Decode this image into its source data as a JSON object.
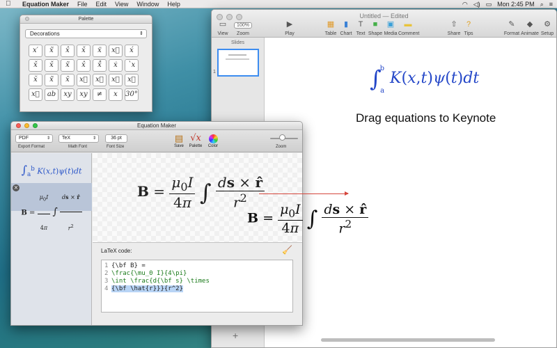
{
  "menubar": {
    "app_name": "Equation Maker",
    "items": [
      "File",
      "Edit",
      "View",
      "Window",
      "Help"
    ],
    "right_text": "Mon 2:45 PM"
  },
  "keynote": {
    "title": "Untitled — Edited",
    "zoom_value": "100%",
    "tools_left": [
      {
        "label": "View",
        "icon": "view-icon"
      },
      {
        "label": "Zoom",
        "icon": "zoom-icon"
      },
      {
        "label": "Play",
        "icon": "play-icon"
      }
    ],
    "tools_mid": [
      {
        "label": "Table",
        "icon": "table-icon"
      },
      {
        "label": "Chart",
        "icon": "chart-icon"
      },
      {
        "label": "Text",
        "icon": "text-icon"
      },
      {
        "label": "Shape",
        "icon": "shape-icon"
      },
      {
        "label": "Media",
        "icon": "media-icon"
      },
      {
        "label": "Comment",
        "icon": "comment-icon"
      }
    ],
    "tools_right": [
      {
        "label": "Share",
        "icon": "share-icon"
      },
      {
        "label": "Tips",
        "icon": "tips-icon"
      },
      {
        "label": "Format",
        "icon": "format-icon"
      },
      {
        "label": "Animate",
        "icon": "animate-icon"
      },
      {
        "label": "Setup",
        "icon": "setup-icon"
      }
    ],
    "slides_label": "Slides",
    "slide_number": "1",
    "canvas_caption": "Drag equations to Keynote",
    "canvas_equation": "∫ₐᵇ K(x,t)ψ(t)dt"
  },
  "palette": {
    "title": "Palette",
    "selected": "Decorations",
    "symbols": [
      "x′",
      "x̃",
      "x̂",
      "x̌",
      "ẍ",
      "x⃛",
      "x́",
      "x̌",
      "x̌",
      "x̃",
      "x̂",
      "x̊",
      "ẋ",
      "`x",
      "x̆",
      "x̃",
      "x̄",
      "x⃗",
      "x⃡",
      "x⃖",
      "x⃡",
      "x⃗",
      "ab",
      "xy",
      "xy",
      "≠",
      "x",
      "30°"
    ]
  },
  "equation_maker": {
    "title": "Equation Maker",
    "export_format": {
      "label": "Export Format",
      "value": "PDF"
    },
    "math_font": {
      "label": "Math Font",
      "value": "TeX"
    },
    "font_size": {
      "label": "Font Size",
      "value": "36 pt"
    },
    "buttons": [
      {
        "label": "Save",
        "icon": "save-icon"
      },
      {
        "label": "Palette",
        "icon": "palette-icon"
      },
      {
        "label": "Color",
        "icon": "color-wheel-icon"
      }
    ],
    "zoom_label": "Zoom",
    "latex_label": "LaTeX code:",
    "code_lines": [
      {
        "n": "1",
        "text": "{\\bf B} ="
      },
      {
        "n": "2",
        "text": "\\frac{\\mu_0 I}{4\\pi}"
      },
      {
        "n": "3",
        "text": "\\int \\frac{d{\\bf s} \\times"
      },
      {
        "n": "4",
        "text": "{\\bf \\hat{r}}}{r^2}"
      }
    ]
  },
  "colors": {
    "accent_blue": "#2447c8",
    "drag_arrow": "#d5463c",
    "selection": "#b9c5d8"
  }
}
